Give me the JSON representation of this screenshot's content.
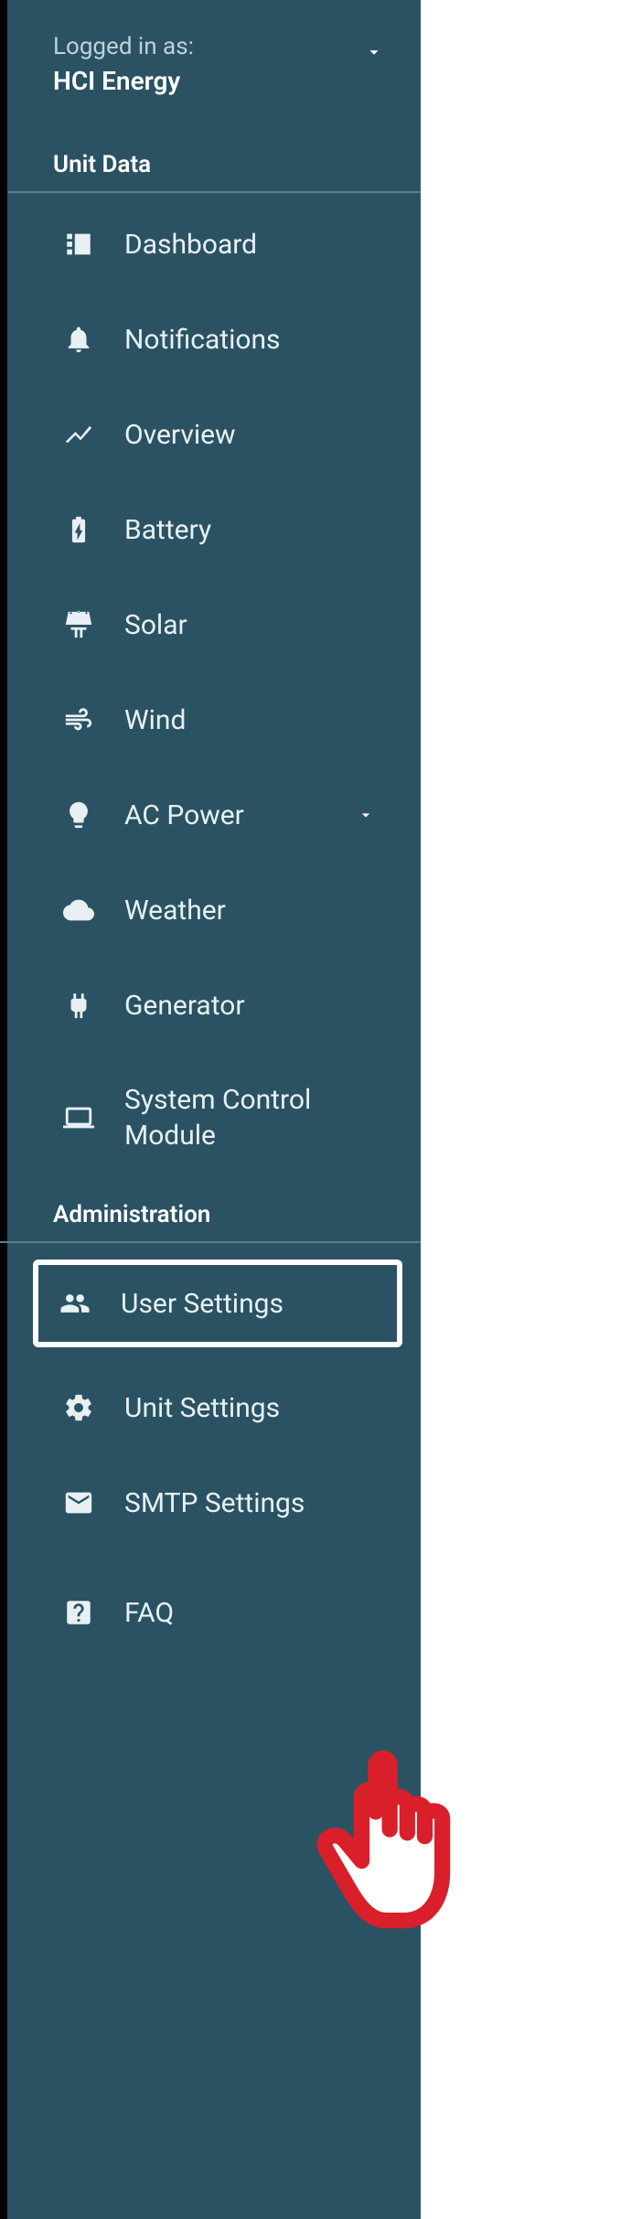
{
  "login": {
    "prefix": "Logged in as:",
    "user": "HCI Energy"
  },
  "sections": {
    "unit_data": "Unit Data",
    "administration": "Administration"
  },
  "nav": {
    "dashboard": "Dashboard",
    "notifications": "Notifications",
    "overview": "Overview",
    "battery": "Battery",
    "solar": "Solar",
    "wind": "Wind",
    "ac_power": "AC Power",
    "weather": "Weather",
    "generator": "Generator",
    "system_control_module": "System Control Module",
    "user_settings": "User Settings",
    "unit_settings": "Unit Settings",
    "smtp_settings": "SMTP Settings",
    "faq": "FAQ"
  }
}
